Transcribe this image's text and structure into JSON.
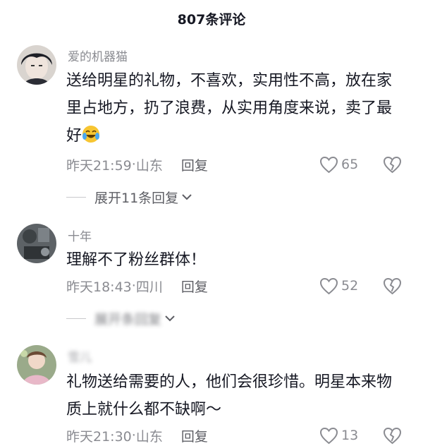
{
  "header": {
    "title": "807条评论"
  },
  "comments": [
    {
      "username": "爱的机器猫",
      "text": "送给明星的礼物，不喜欢，实用性不高，放在家里占地方，扔了浪费，从实用角度来说，卖了最好",
      "emoji": "laughing-crying-emoji",
      "time": "昨天21:59",
      "location": "山东",
      "reply_label": "回复",
      "likes": "65",
      "expand_label": "展开11条回复"
    },
    {
      "username": "十年",
      "text": "理解不了粉丝群体！",
      "time": "昨天18:43",
      "location": "四川",
      "reply_label": "回复",
      "likes": "52",
      "expand_label": "展开条回复"
    },
    {
      "username": "雪儿",
      "text": "礼物送给需要的人，他们会很珍惜。明星本来物质上就什么都不缺啊～",
      "time": "昨天21:30",
      "location": "山东",
      "reply_label": "回复",
      "likes": "13"
    }
  ],
  "meta_separator": " · ",
  "colors": {
    "text": "#161823",
    "meta": "#8a8b91",
    "line": "#c8c8cc"
  }
}
